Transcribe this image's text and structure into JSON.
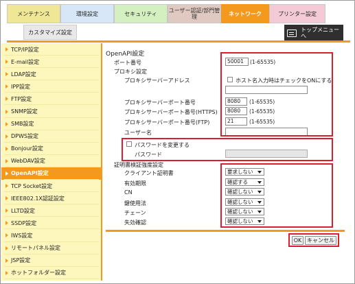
{
  "tabs": {
    "maintenance": "メンテナンス",
    "environment": "環境設定",
    "security": "セキュリティ",
    "user_auth": "ユーザー認証/部門管理",
    "network": "ネットワーク",
    "printer": "プリンター設定",
    "customize": "カスタマイズ設定",
    "top_menu": "トップメニューへ"
  },
  "sidebar": {
    "items": [
      {
        "label": "TCP/IP設定"
      },
      {
        "label": "E-mail設定"
      },
      {
        "label": "LDAP設定"
      },
      {
        "label": "IPP設定"
      },
      {
        "label": "FTP設定"
      },
      {
        "label": "SNMP設定"
      },
      {
        "label": "SMB設定"
      },
      {
        "label": "DPWS設定"
      },
      {
        "label": "Bonjour設定"
      },
      {
        "label": "WebDAV設定"
      },
      {
        "label": "OpenAPI設定"
      },
      {
        "label": "TCP Socket設定"
      },
      {
        "label": "IEEE802.1X認証設定"
      },
      {
        "label": "LLTD設定"
      },
      {
        "label": "SSDP設定"
      },
      {
        "label": "IWS設定"
      },
      {
        "label": "リモートパネル設定"
      },
      {
        "label": "JSP設定"
      },
      {
        "label": "ホットフォルダー設定"
      }
    ],
    "active_index": 10
  },
  "main": {
    "title": "OpenAPI設定",
    "port_label": "ポート番号",
    "port_value": "50001",
    "port_range": "(1-65535)",
    "proxy_section": "プロキシ設定",
    "proxy_address_label": "プロキシサーバーアドレス",
    "proxy_address_value": "",
    "hostname_check_label": "ホスト名入力時はチェックをONにする",
    "proxy_port_label": "プロキシサーバーポート番号",
    "proxy_port_value": "8080",
    "proxy_port_range": "(1-65535)",
    "proxy_port_https_label": "プロキシサーバーポート番号(HTTPS)",
    "proxy_port_https_value": "8080",
    "proxy_port_https_range": "(1-65535)",
    "proxy_port_ftp_label": "プロキシサーバーポート番号(FTP)",
    "proxy_port_ftp_value": "21",
    "proxy_port_ftp_range": "(1-65535)",
    "username_label": "ユーザー名",
    "username_value": "",
    "change_password_label": "パスワードを変更する",
    "password_label": "パスワード",
    "password_value": "",
    "cert_section": "証明書検証強度設定",
    "client_cert_label": "クライアント証明書",
    "client_cert_value": "要求しない",
    "validity_label": "有効期限",
    "validity_value": "確認する",
    "cn_label": "CN",
    "cn_value": "確認しない",
    "key_usage_label": "鍵使用法",
    "key_usage_value": "確認しない",
    "chain_label": "チェーン",
    "chain_value": "確認しない",
    "revocation_label": "失効確認",
    "revocation_value": "確認しない",
    "ok_button": "OK",
    "cancel_button": "キャンセル"
  },
  "colors": {
    "accent": "#f39a1e",
    "highlight_box": "#d9202a",
    "sidebar_bg": "#fdf6bd"
  }
}
